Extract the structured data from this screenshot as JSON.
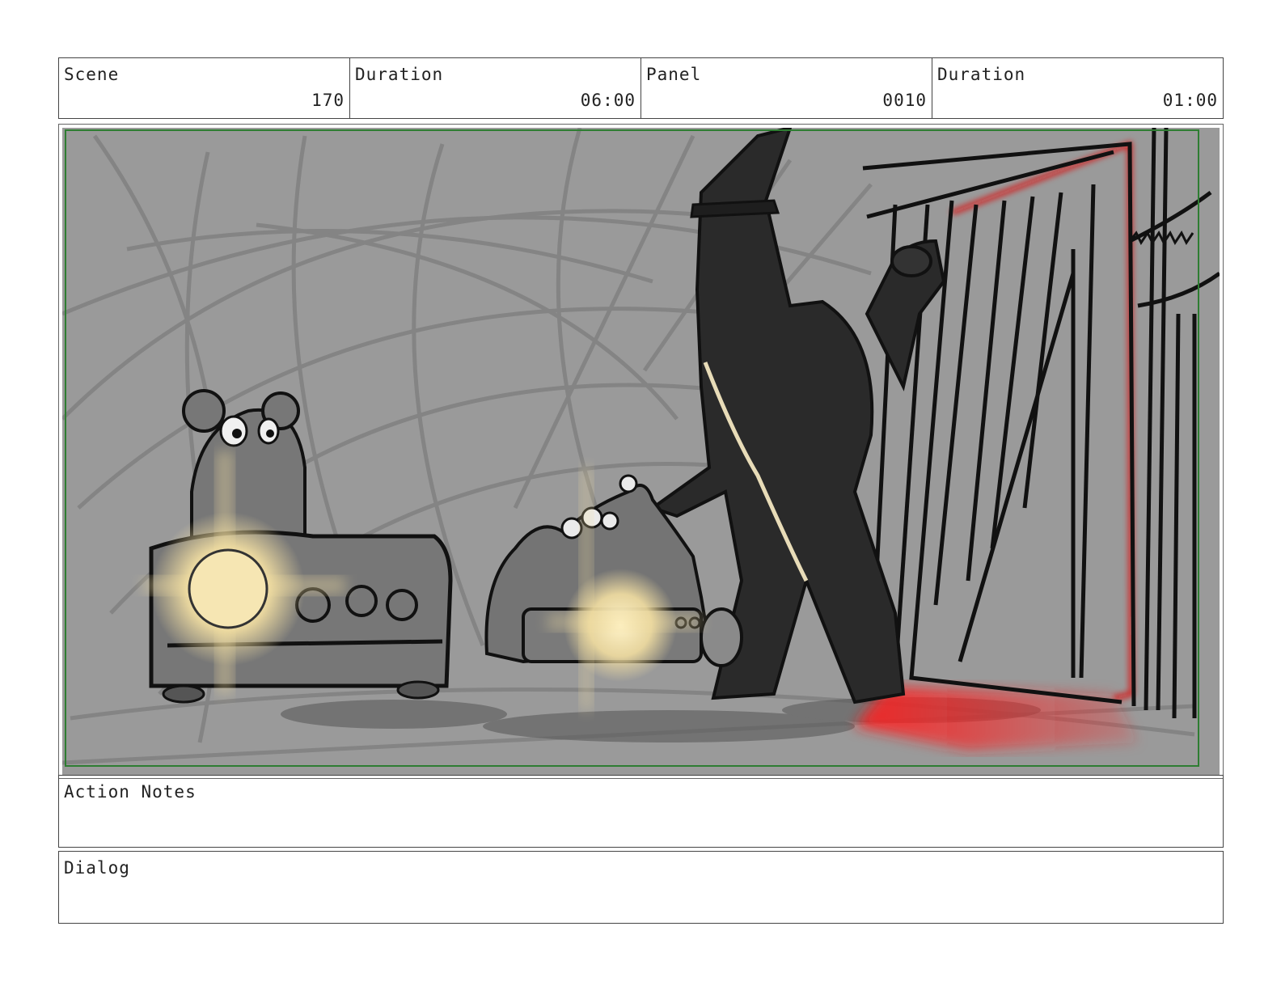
{
  "header": {
    "scene_label": "Scene",
    "scene_value": "170",
    "scene_duration_label": "Duration",
    "scene_duration_value": "06:00",
    "panel_label": "Panel",
    "panel_value": "0010",
    "panel_duration_label": "Duration",
    "panel_duration_value": "01:00"
  },
  "action_notes": {
    "label": "Action Notes"
  },
  "dialog": {
    "label": "Dialog"
  },
  "colors": {
    "background": "#9a9a9a",
    "frame_line": "#2e7d32",
    "glow": "#f3dfa2",
    "door_light": "#e01010",
    "silhouette": "#2a2a2a"
  }
}
